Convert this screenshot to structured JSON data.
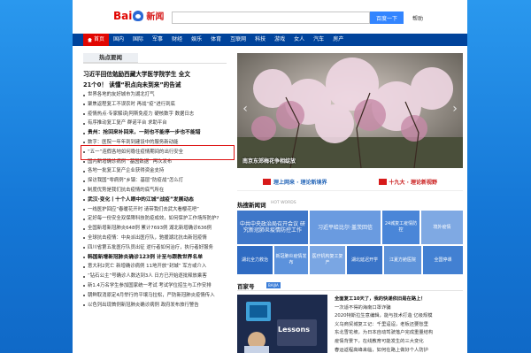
{
  "header": {
    "logo_text": "Bai",
    "logo_news": "新闻",
    "search_placeholder": "",
    "search_button": "百度一下",
    "help": "帮助"
  },
  "nav": [
    "首页",
    "国内",
    "国际",
    "军事",
    "财经",
    "娱乐",
    "体育",
    "互联网",
    "科技",
    "游戏",
    "女人",
    "汽车",
    "房产"
  ],
  "hot_news": {
    "tab": "热点要闻",
    "headline1": "习近平回信勉励西藏大学医学院学生 全文",
    "headline2": "21个0！ 读懂“积点向未到来”的告诫",
    "items": [
      {
        "text": "世界各地的友好城市为湖北打气",
        "bold": false
      },
      {
        "text": "聚焦返程复工不误农时 再战“疫”进行到底",
        "bold": false
      },
      {
        "text": "疫情热点·专家解读|阿斯免疫力 硬核数字 数据日志",
        "bold": false
      },
      {
        "text": "有序推动复工复产 群诺平台 求助平台",
        "bold": false
      },
      {
        "text": "贵州：抢回来补回来，一刻也不能停一步也不能错",
        "bold": true
      },
      {
        "text": "数字：医院一年年到到建设中的服务新动能",
        "bold": false
      },
      {
        "text": "“五一”连假各地如何稳住疫情期间的出行安全",
        "bold": false
      },
      {
        "text": "国内新增确诊病例 “基因数据” 再次发布",
        "bold": false
      },
      {
        "text": "各地一批复工复产企业获得资金支持",
        "bold": false
      },
      {
        "text": "探访我国“零病例”乡镇：基层“防疫战”怎么打",
        "bold": false
      },
      {
        "text": "制度优势是我们抗击疫情的底气所在",
        "bold": false
      },
      {
        "text": "武汉·变化丨十个人眼中的江城“战疫”发展动态",
        "bold": true
      },
      {
        "text": "一线医护回应“春暖花开时 请带我们去武大看樱花吧”",
        "bold": false
      },
      {
        "text": "定好每一份安全双保障科技防疫成效，如何保护工作场所防护?",
        "bold": false
      },
      {
        "text": "全国新增新冠肺炎648例 累计7693例 湖北新增确诊636例",
        "bold": false
      },
      {
        "text": "全球抗击疫情：中央派出医疗队，驰援湖北抗击新冠疫情",
        "bold": false
      },
      {
        "text": "四川省第五批医疗队员出征 逆行者如何治疗，执行者好服务",
        "bold": false
      },
      {
        "text": "韩国新增新冠肺炎确诊123例 计至与跟教世界名单",
        "bold": true
      },
      {
        "text": "意大利2死亡 新增确诊病例 11地开放“封城” 军方或介入",
        "bold": false
      },
      {
        "text": "“钻石公主”号确诊人数达到3人 日方已开始逐批释放乘客",
        "bold": false
      },
      {
        "text": "新1.4万名学生参加国家统一考试 考试学位招生与工作安排",
        "bold": false
      },
      {
        "text": "朝鲜取消原定4月举行的平壤马拉松，严防新冠肺炎疫情传入",
        "bold": false
      },
      {
        "text": "以色列出现首例新冠肺炎确诊病例 政府发布旅行警告",
        "bold": false
      }
    ]
  },
  "hero": {
    "caption": "南京东郊梅花争相绽放"
  },
  "banners": {
    "b1": "理上网来 · 理论新境界",
    "b2": "十九大 · 理论新视野"
  },
  "hot_words": {
    "title": "热搜新闻词",
    "sub": "HOT WORDS",
    "tiles": [
      {
        "text": "中共中央政治局召开会议 研究新冠肺炎疫情防控工作",
        "color": "#3f77c9"
      },
      {
        "text": "习近平给比尔·盖茨回信",
        "color": "#6a9be0"
      },
      {
        "text": "24城复工疫情防控",
        "color": "#4a86d8"
      },
      {
        "text": "境外疫情",
        "color": "#7fa9e3"
      },
      {
        "text": "湖北全力救治",
        "color": "#2f6bc2"
      },
      {
        "text": "新冠肺炎疫情发布",
        "color": "#5c92dc"
      },
      {
        "text": "医疗机构复工复产",
        "color": "#7aa6e3"
      },
      {
        "text": "湖北延迟开学",
        "color": "#3a74c8"
      },
      {
        "text": "江夏方舱医院",
        "color": "#5e93da"
      },
      {
        "text": "全国停课",
        "color": "#4280d2"
      }
    ]
  },
  "baijia": {
    "title": "百家号",
    "badge": "BAIJIA",
    "lessons": "Lessons",
    "items": [
      {
        "text": "全面复工10天了，我的快递依旧是在路上！",
        "bold": true
      },
      {
        "text": "一次适不得的海南口罩诈骗",
        "bold": false
      },
      {
        "text": "2020特斯拉生意编辑，能与技术打造 亿级规模",
        "bold": false
      },
      {
        "text": "义乌商贸城复工记：千里迢迢，老板还要愁里",
        "bold": false
      },
      {
        "text": "东北雪花坡，为日本自动驾驶落户完成重量结构",
        "bold": false
      },
      {
        "text": "疫情背景下，在线教育可能发生的三大变化",
        "bold": false
      },
      {
        "text": "春运返程高峰来临，如何在路上做好个人防护",
        "bold": false
      }
    ]
  }
}
